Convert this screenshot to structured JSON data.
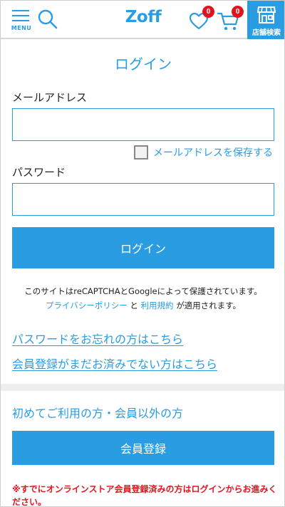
{
  "header": {
    "menu_label": "MENU",
    "logo_text": "Zoff",
    "favorites_count": "0",
    "cart_count": "0",
    "store_search_label": "店舗検索",
    "accent_color": "#2a9de2",
    "badge_color": "#e1141e",
    "icons": [
      "menu-icon",
      "search-icon",
      "heart-icon",
      "cart-icon",
      "store-icon"
    ]
  },
  "login": {
    "title": "ログイン",
    "email_label": "メールアドレス",
    "email_value": "",
    "save_email_label": "メールアドレスを保存する",
    "save_email_checked": false,
    "password_label": "パスワード",
    "password_value": "",
    "submit_label": "ログイン",
    "recaptcha_note": "このサイトはreCAPTCHAとGoogleによって保護されています。",
    "privacy_link": "プライバシーポリシー",
    "and_text": "と",
    "terms_link": "利用規約",
    "applies_text": "が適用されます。",
    "forgot_password_link": "パスワードをお忘れの方はこちら",
    "not_registered_link": "会員登録がまだお済みでない方はこちら"
  },
  "register": {
    "heading": "初めてご利用の方・会員以外の方",
    "button_label": "会員登録",
    "warning": "※すでにオンラインストア会員登録済みの方はログインからお進みください。"
  }
}
